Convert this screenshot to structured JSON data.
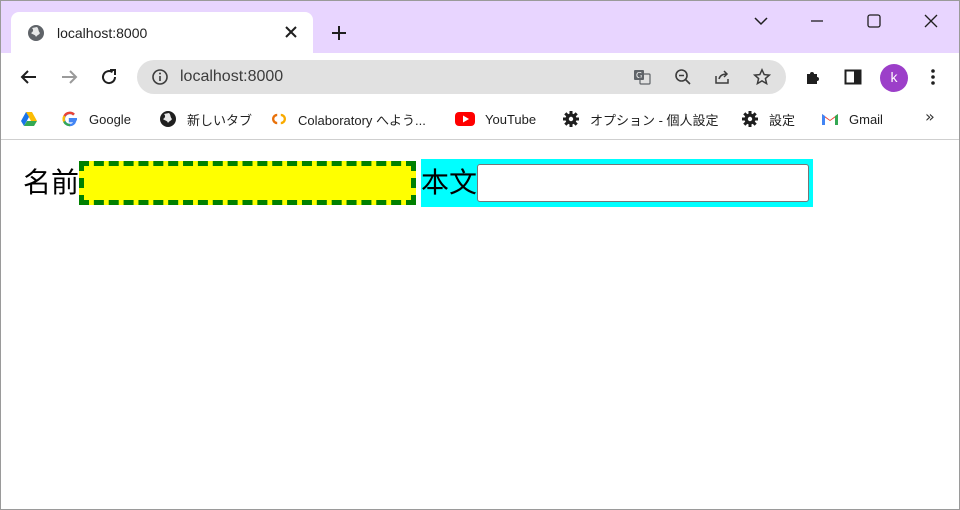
{
  "browser": {
    "tab": {
      "title": "localhost:8000"
    },
    "new_tab_symbol": "+",
    "window_controls": [
      "chevron-down",
      "minimize",
      "maximize",
      "close"
    ],
    "address_bar": {
      "url": "localhost:8000"
    },
    "profile": {
      "initial": "k",
      "color": "#9c3fc9"
    },
    "titlebar_color": "#e8d5ff"
  },
  "bookmarks": {
    "items": [
      {
        "label": "",
        "icon": "google-drive-icon"
      },
      {
        "label": "Google",
        "icon": "google-g-icon"
      },
      {
        "label": "新しいタブ",
        "icon": "globe-icon"
      },
      {
        "label": "Colaboratory へよう...",
        "icon": "colab-icon"
      },
      {
        "label": "YouTube",
        "icon": "youtube-icon"
      },
      {
        "label": "オプション - 個人設定",
        "icon": "gear-icon"
      },
      {
        "label": "設定",
        "icon": "gear-icon"
      },
      {
        "label": "Gmail",
        "icon": "gmail-icon"
      }
    ],
    "more": "»"
  },
  "form": {
    "name_label": "名前",
    "name_value": "",
    "name_bg": "#ffff00",
    "name_border": "#008000",
    "body_label": "本文",
    "body_value": "",
    "body_bg": "#00ffff"
  }
}
